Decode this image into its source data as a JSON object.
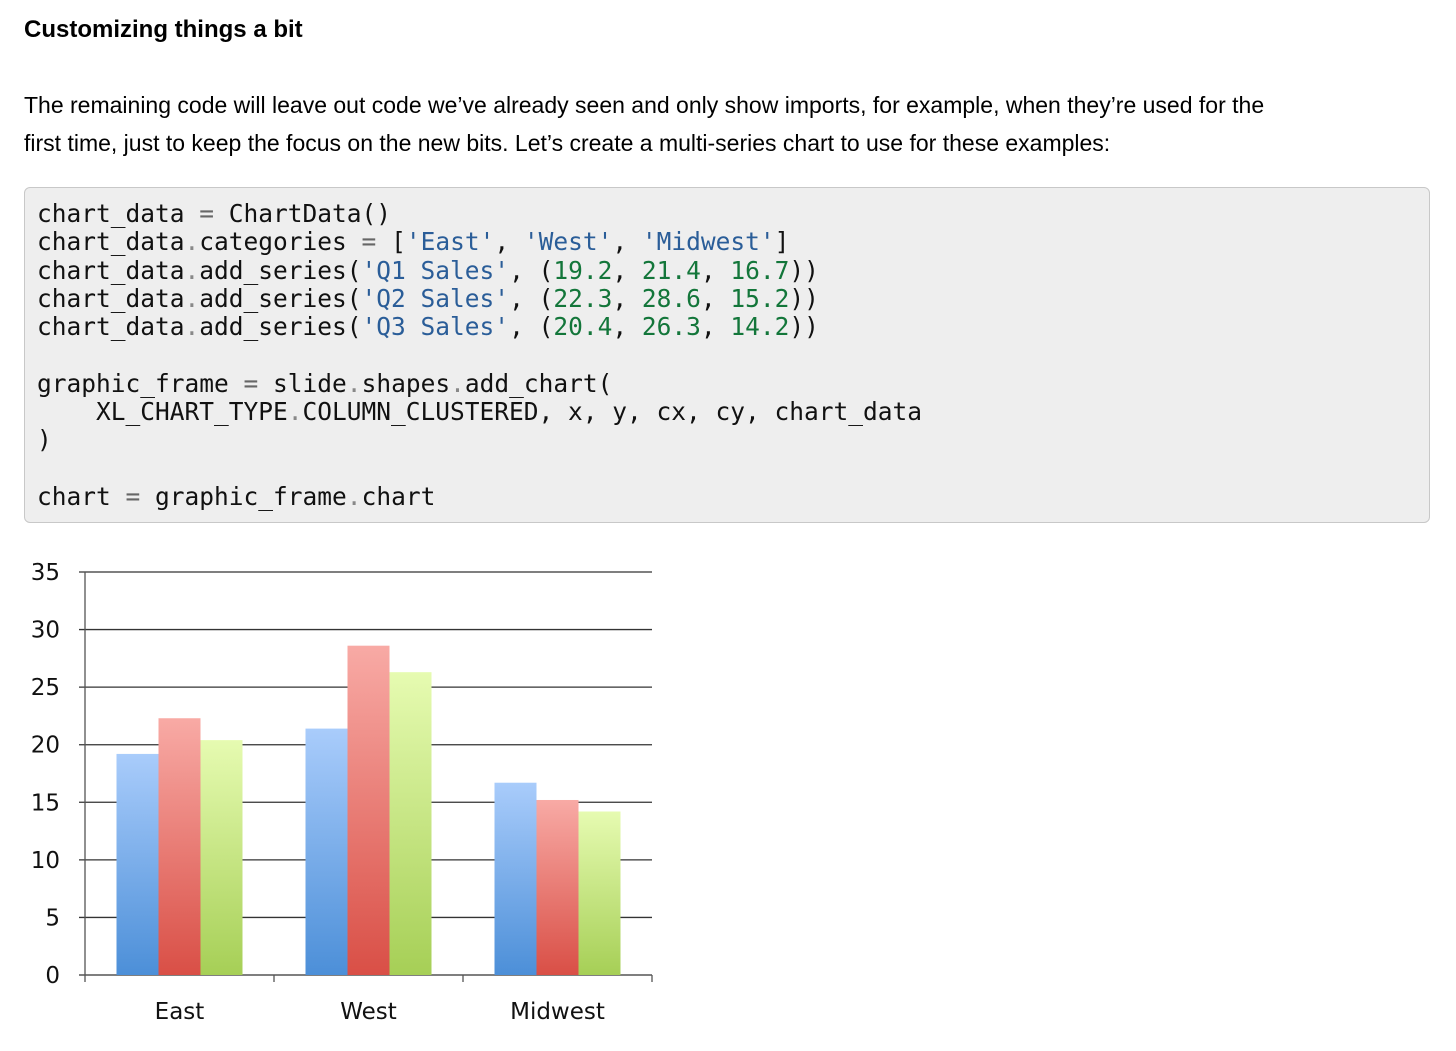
{
  "heading": "Customizing things a bit",
  "paragraph_line1": "The remaining code will leave out code we’ve already seen and only show imports, for example, when they’re used for the",
  "paragraph_line2": "first time, just to keep the focus on the new bits. Let’s create a multi-series chart to use for these examples:",
  "code_lines": [
    [
      [
        "t",
        "chart_data "
      ],
      [
        "o",
        "="
      ],
      [
        "t",
        " ChartData()"
      ]
    ],
    [
      [
        "t",
        "chart_data"
      ],
      [
        "d",
        "."
      ],
      [
        "t",
        "categories "
      ],
      [
        "o",
        "="
      ],
      [
        "t",
        " ["
      ],
      [
        "s",
        "'East'"
      ],
      [
        "t",
        ", "
      ],
      [
        "s",
        "'West'"
      ],
      [
        "t",
        ", "
      ],
      [
        "s",
        "'Midwest'"
      ],
      [
        "t",
        "]"
      ]
    ],
    [
      [
        "t",
        "chart_data"
      ],
      [
        "d",
        "."
      ],
      [
        "t",
        "add_series("
      ],
      [
        "s",
        "'Q1 Sales'"
      ],
      [
        "t",
        ", ("
      ],
      [
        "n",
        "19.2"
      ],
      [
        "t",
        ", "
      ],
      [
        "n",
        "21.4"
      ],
      [
        "t",
        ", "
      ],
      [
        "n",
        "16.7"
      ],
      [
        "t",
        "))"
      ]
    ],
    [
      [
        "t",
        "chart_data"
      ],
      [
        "d",
        "."
      ],
      [
        "t",
        "add_series("
      ],
      [
        "s",
        "'Q2 Sales'"
      ],
      [
        "t",
        ", ("
      ],
      [
        "n",
        "22.3"
      ],
      [
        "t",
        ", "
      ],
      [
        "n",
        "28.6"
      ],
      [
        "t",
        ", "
      ],
      [
        "n",
        "15.2"
      ],
      [
        "t",
        "))"
      ]
    ],
    [
      [
        "t",
        "chart_data"
      ],
      [
        "d",
        "."
      ],
      [
        "t",
        "add_series("
      ],
      [
        "s",
        "'Q3 Sales'"
      ],
      [
        "t",
        ", ("
      ],
      [
        "n",
        "20.4"
      ],
      [
        "t",
        ", "
      ],
      [
        "n",
        "26.3"
      ],
      [
        "t",
        ", "
      ],
      [
        "n",
        "14.2"
      ],
      [
        "t",
        "))"
      ]
    ],
    [],
    [
      [
        "t",
        "graphic_frame "
      ],
      [
        "o",
        "="
      ],
      [
        "t",
        " slide"
      ],
      [
        "d",
        "."
      ],
      [
        "t",
        "shapes"
      ],
      [
        "d",
        "."
      ],
      [
        "t",
        "add_chart("
      ]
    ],
    [
      [
        "t",
        "    XL_CHART_TYPE"
      ],
      [
        "d",
        "."
      ],
      [
        "t",
        "COLUMN_CLUSTERED, x, y, cx, cy, chart_data"
      ]
    ],
    [
      [
        "t",
        ")"
      ]
    ],
    [],
    [
      [
        "t",
        "chart "
      ],
      [
        "o",
        "="
      ],
      [
        "t",
        " graphic_frame"
      ],
      [
        "d",
        "."
      ],
      [
        "t",
        "chart"
      ]
    ]
  ],
  "colors": {
    "code_string": "#2a5d98",
    "code_number": "#13763a",
    "code_background": "#eeeeee",
    "series": [
      {
        "top": "#a9ccfb",
        "bottom": "#4c8fd8"
      },
      {
        "top": "#f8aaa5",
        "bottom": "#d94f46"
      },
      {
        "top": "#e6fbb1",
        "bottom": "#a6cf56"
      }
    ]
  },
  "chart_data": {
    "type": "bar",
    "categories": [
      "East",
      "West",
      "Midwest"
    ],
    "series": [
      {
        "values": [
          19.2,
          21.4,
          16.7
        ]
      },
      {
        "values": [
          22.3,
          28.6,
          15.2
        ]
      },
      {
        "values": [
          20.4,
          26.3,
          14.2
        ]
      }
    ],
    "yticks": [
      "0",
      "5",
      "10",
      "15",
      "20",
      "25",
      "30",
      "35"
    ],
    "ylim": [
      0,
      35
    ],
    "grid": true,
    "legend": "none",
    "title": "",
    "xlabel": "",
    "ylabel": ""
  }
}
